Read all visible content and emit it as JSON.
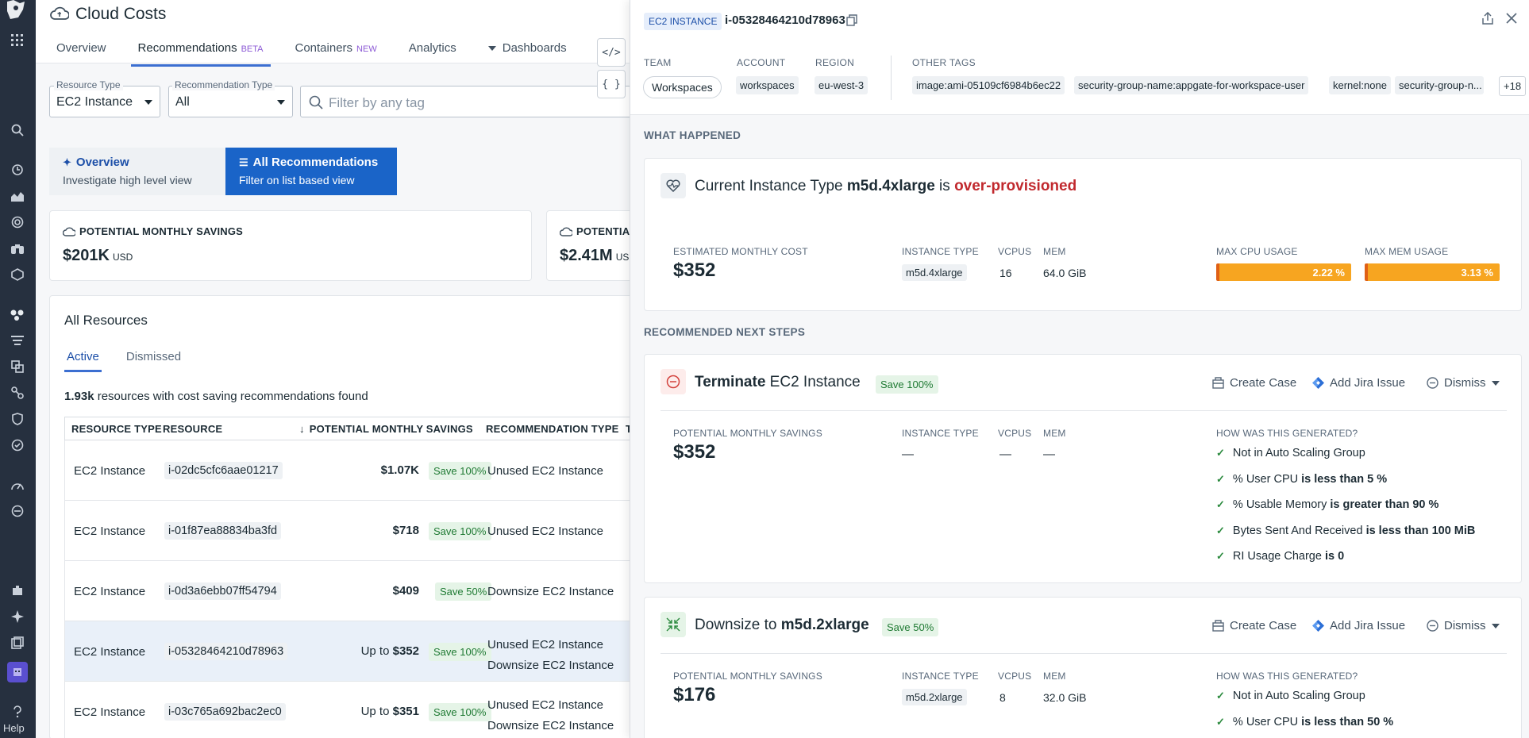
{
  "app": {
    "title": "Cloud Costs",
    "help_label": "Help"
  },
  "tabs": [
    {
      "label": "Overview",
      "badge": ""
    },
    {
      "label": "Recommendations",
      "badge": "BETA"
    },
    {
      "label": "Containers",
      "badge": "NEW"
    },
    {
      "label": "Analytics",
      "badge": ""
    },
    {
      "label": "Dashboards",
      "badge": ""
    }
  ],
  "filters": {
    "resource_type_label": "Resource Type",
    "resource_type_value": "EC2 Instance",
    "rec_type_label": "Recommendation Type",
    "rec_type_value": "All",
    "search_placeholder": "Filter by any tag"
  },
  "views": {
    "overview_title": "Overview",
    "overview_sub": "Investigate high level view",
    "all_title": "All Recommendations",
    "all_sub": "Filter on list based view"
  },
  "savings_cards": [
    {
      "label": "POTENTIAL MONTHLY SAVINGS",
      "value": "$201K",
      "unit": "USD"
    },
    {
      "label": "POTENTIA",
      "value": "$2.41M",
      "unit": "US"
    }
  ],
  "resources": {
    "title": "All Resources",
    "tab_active": "Active",
    "tab_dismissed": "Dismissed",
    "count_bold": "1.93k",
    "count_text": " resources with cost saving recommendations found",
    "headers": [
      "RESOURCE TYPE",
      "RESOURCE",
      "POTENTIAL MONTHLY SAVINGS",
      "RECOMMENDATION TYPE",
      "T"
    ],
    "rows": [
      {
        "type": "EC2 Instance",
        "id": "i-02dc5cfc6aae01217",
        "prefix": "",
        "amount": "$1.07K",
        "save": "Save 100%",
        "rec1": "Unused EC2 Instance",
        "rec2": ""
      },
      {
        "type": "EC2 Instance",
        "id": "i-01f87ea88834ba3fd",
        "prefix": "",
        "amount": "$718",
        "save": "Save 100%",
        "rec1": "Unused EC2 Instance",
        "rec2": ""
      },
      {
        "type": "EC2 Instance",
        "id": "i-0d3a6ebb07ff54794",
        "prefix": "",
        "amount": "$409",
        "save": "Save 50%",
        "rec1": "Downsize EC2 Instance",
        "rec2": ""
      },
      {
        "type": "EC2 Instance",
        "id": "i-05328464210d78963",
        "prefix": "Up to ",
        "amount": "$352",
        "save": "Save 100%",
        "rec1": "Unused EC2 Instance",
        "rec2": "Downsize EC2 Instance"
      },
      {
        "type": "EC2 Instance",
        "id": "i-03c765a692bac2ec0",
        "prefix": "Up to ",
        "amount": "$351",
        "save": "Save 100%",
        "rec1": "Unused EC2 Instance",
        "rec2": "Downsize EC2 Instance"
      }
    ]
  },
  "drawer": {
    "type_tag": "EC2 INSTANCE",
    "instance_id": "i-05328464210d78963",
    "team_label": "TEAM",
    "team_value": "Workspaces",
    "account_label": "ACCOUNT",
    "account_value": "workspaces",
    "region_label": "REGION",
    "region_value": "eu-west-3",
    "other_tags_label": "OTHER TAGS",
    "other_tags": [
      "image:ami-05109cf6984b6ec22",
      "security-group-name:appgate-for-workspace-user",
      "kernel:none",
      "security-group-n..."
    ],
    "more_tags": "+18",
    "what_happened": "WHAT HAPPENED",
    "current_prefix": "Current Instance Type ",
    "current_type": "m5d.4xlarge",
    "current_is": " is ",
    "current_status": "over-provisioned",
    "est_cost_label": "ESTIMATED MONTHLY COST",
    "est_cost_value": "$352",
    "instance_type_label": "INSTANCE TYPE",
    "instance_type_value": "m5d.4xlarge",
    "vcpus_label": "VCPUS",
    "vcpus_value": "16",
    "mem_label": "MEM",
    "mem_value": "64.0 GiB",
    "max_cpu_label": "MAX CPU USAGE",
    "max_cpu_value": "2.22 %",
    "max_mem_label": "MAX MEM USAGE",
    "max_mem_value": "3.13 %",
    "next_steps": "RECOMMENDED NEXT STEPS",
    "terminate": {
      "verb": "Terminate",
      "target": " EC2 Instance",
      "save": "Save 100%",
      "savings_label": "POTENTIAL MONTHLY SAVINGS",
      "savings_value": "$352",
      "instance_type_label": "INSTANCE TYPE",
      "instance_type_value": "—",
      "vcpus_label": "VCPUS",
      "vcpus_value": "—",
      "mem_label": "MEM",
      "mem_value": "—",
      "how_label": "HOW WAS THIS GENERATED?",
      "checks": [
        {
          "text": "Not in Auto Scaling Group",
          "cond": ""
        },
        {
          "text": "% User CPU ",
          "cond": "is less than 5 %"
        },
        {
          "text": "% Usable Memory ",
          "cond": "is greater than 90 %"
        },
        {
          "text": "Bytes Sent And Received ",
          "cond": "is less than 100 MiB"
        },
        {
          "text": "RI Usage Charge ",
          "cond": "is 0"
        }
      ]
    },
    "downsize": {
      "verb": "Downsize to ",
      "target": "m5d.2xlarge",
      "save": "Save 50%",
      "savings_label": "POTENTIAL MONTHLY SAVINGS",
      "savings_value": "$176",
      "instance_type_label": "INSTANCE TYPE",
      "instance_type_value": "m5d.2xlarge",
      "vcpus_label": "VCPUS",
      "vcpus_value": "8",
      "mem_label": "MEM",
      "mem_value": "32.0 GiB",
      "how_label": "HOW WAS THIS GENERATED?",
      "checks": [
        {
          "text": "Not in Auto Scaling Group",
          "cond": ""
        },
        {
          "text": "% User CPU ",
          "cond": "is less than 50 %"
        }
      ]
    },
    "actions": {
      "create_case": "Create Case",
      "add_jira": "Add Jira Issue",
      "dismiss": "Dismiss"
    }
  },
  "colors": {
    "accent": "#3c6fd1",
    "active_view_bg": "#1a64c8",
    "over_provisioned": "#c1292e",
    "bar_fill": "#f7a520",
    "save_green": "#1f7a33"
  },
  "usage": {
    "max_cpu_fraction": 0.0222,
    "max_mem_fraction": 0.0313
  }
}
